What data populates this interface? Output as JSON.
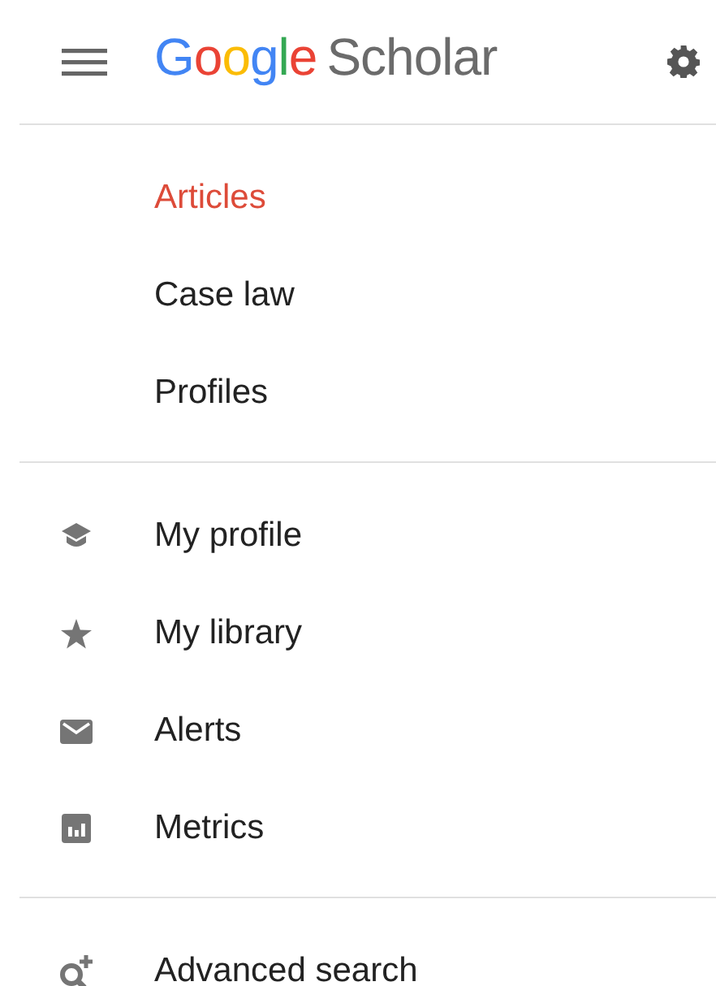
{
  "header": {
    "logo": {
      "brand": "Google",
      "product": "Scholar"
    }
  },
  "sections": [
    {
      "items": [
        {
          "label": "Articles",
          "selected": true
        },
        {
          "label": "Case law",
          "selected": false
        },
        {
          "label": "Profiles",
          "selected": false
        }
      ]
    },
    {
      "items": [
        {
          "label": "My profile"
        },
        {
          "label": "My library"
        },
        {
          "label": "Alerts"
        },
        {
          "label": "Metrics"
        }
      ]
    },
    {
      "items": [
        {
          "label": "Advanced search"
        }
      ]
    }
  ]
}
